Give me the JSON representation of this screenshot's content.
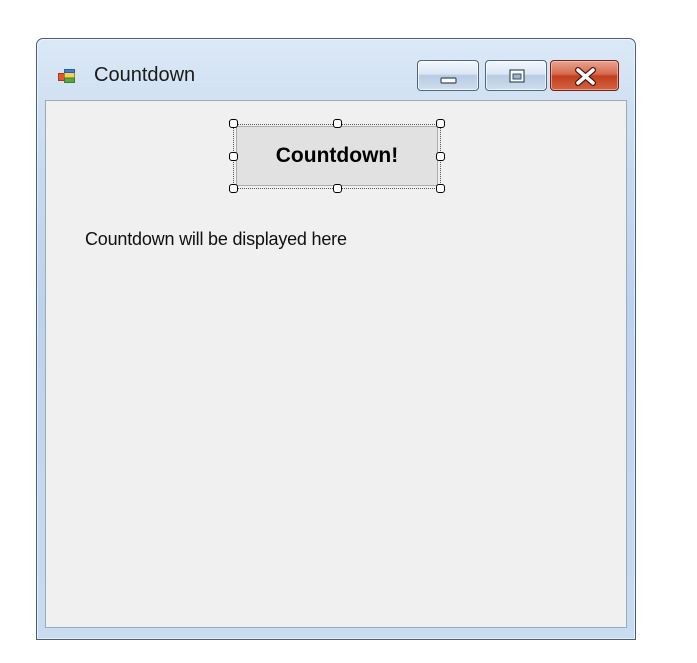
{
  "window": {
    "title": "Countdown"
  },
  "form": {
    "button_label": "Countdown!",
    "label_text": "Countdown will be displayed here"
  },
  "icons": {
    "app": "windows-form-icon",
    "minimize": "minimize-icon",
    "maximize": "maximize-icon",
    "close": "close-icon"
  },
  "colors": {
    "close_button": "#c2401f",
    "client_background": "#f0f0f0",
    "frame": "#c6daef"
  }
}
